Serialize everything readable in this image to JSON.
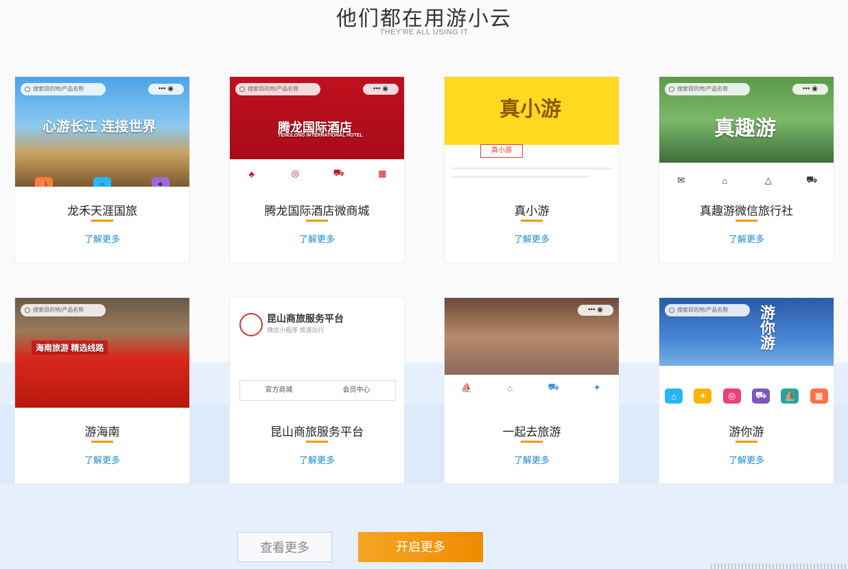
{
  "header": {
    "title": "他们都在用游小云",
    "subtitle": "THEY'RE ALL USING IT"
  },
  "cards": [
    {
      "name": "龙禾天涯国旅",
      "link": "了解更多",
      "search": "搜索目的地/产品名称",
      "banner": "心游长江 连接世界"
    },
    {
      "name": "腾龙国际酒店微商城",
      "link": "了解更多",
      "search": "搜索目的地/产品名称",
      "banner": "腾龙国际酒店",
      "banner_sub": "TENGLONG INTERNATIONAL HOTEL"
    },
    {
      "name": "真小游",
      "link": "了解更多",
      "banner": "真小游",
      "brand": "真小游"
    },
    {
      "name": "真趣游微信旅行社",
      "link": "了解更多",
      "search": "搜索目的地/产品名称",
      "banner": "真趣游"
    },
    {
      "name": "游海南",
      "link": "了解更多",
      "search": "搜索目的地/产品名称",
      "banner": "海南旅游 精选线路"
    },
    {
      "name": "昆山商旅服务平台",
      "link": "了解更多",
      "banner": "昆山商旅服务平台",
      "banner_sub": "微信小程序 旅游出行",
      "buttons": [
        "官方商城",
        "会员中心"
      ]
    },
    {
      "name": "一起去旅游",
      "link": "了解更多"
    },
    {
      "name": "游你游",
      "link": "了解更多",
      "search": "搜索目的地/产品名称",
      "banner": "游你游"
    }
  ],
  "buttons": {
    "more": "查看更多",
    "open": "开启更多"
  },
  "colors": {
    "accent": "#f39800",
    "link": "#1b8bd6",
    "band": "#e6f0fc"
  }
}
